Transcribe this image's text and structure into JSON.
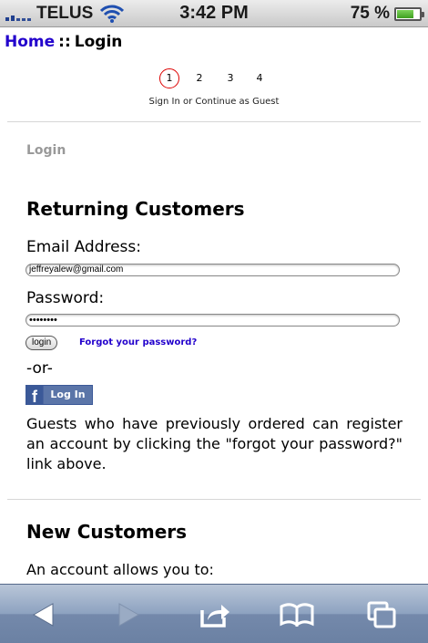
{
  "status_bar": {
    "carrier": "TELUS",
    "time": "3:42 PM",
    "battery_text": "75 %",
    "battery_level": 0.75,
    "signal_icon": "signal-icon",
    "wifi_icon": "wifi-icon",
    "battery_icon": "battery-icon"
  },
  "breadcrumb": {
    "home": "Home",
    "separator": "::",
    "current": "Login"
  },
  "steps": {
    "items": [
      "1",
      "2",
      "3",
      "4"
    ],
    "active_index": 0,
    "caption": "Sign In or Continue as Guest"
  },
  "login_section": {
    "label": "Login",
    "heading": "Returning Customers",
    "email_label": "Email Address:",
    "email_value": "jeffreyalew@gmail.com",
    "password_label": "Password:",
    "password_value": "••••••••",
    "login_button": "login",
    "forgot_link": "Forgot your password?",
    "or_text": "-or-",
    "facebook_button": "Log In",
    "guests_text": "Guests who have previously ordered can register an account by clicking the \"forgot your password?\" link above."
  },
  "new_customers": {
    "heading": "New Customers",
    "intro": "An account allows you to:"
  },
  "toolbar": {
    "back_icon": "back-arrow-icon",
    "forward_icon": "forward-arrow-icon",
    "share_icon": "share-icon",
    "bookmarks_icon": "bookmarks-icon",
    "pages_icon": "pages-icon"
  },
  "colors": {
    "link": "#2200cc",
    "active_step": "#dd0000",
    "facebook": "#3b5998",
    "toolbar": "#7489ab"
  }
}
